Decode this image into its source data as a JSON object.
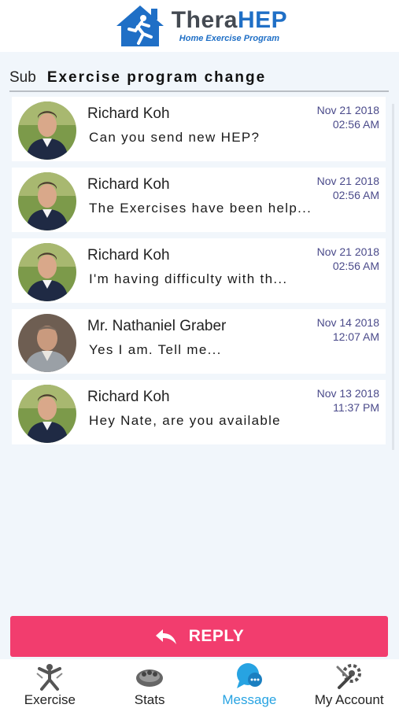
{
  "header": {
    "logo_word_1": "Thera",
    "logo_word_2": "HEP",
    "logo_subtitle": "Home Exercise Program"
  },
  "subject": {
    "label": "Sub",
    "text": "Exercise program change"
  },
  "messages": [
    {
      "name": "Richard Koh",
      "preview": "Can you send new HEP?",
      "date": "Nov 21 2018",
      "time": "02:56 AM",
      "avatar": "richard"
    },
    {
      "name": "Richard Koh",
      "preview": "The Exercises have been help...",
      "date": "Nov 21 2018",
      "time": "02:56 AM",
      "avatar": "richard"
    },
    {
      "name": "Richard Koh",
      "preview": "I'm having difficulty with th...",
      "date": "Nov 21 2018",
      "time": "02:56 AM",
      "avatar": "richard"
    },
    {
      "name": "Mr. Nathaniel Graber",
      "preview": "Yes I am. Tell me...",
      "date": "Nov 14 2018",
      "time": "12:07 AM",
      "avatar": "nathaniel"
    },
    {
      "name": "Richard Koh",
      "preview": "Hey Nate, are you available",
      "date": "Nov 13 2018",
      "time": "11:37 PM",
      "avatar": "richard"
    }
  ],
  "reply": {
    "label": "REPLY"
  },
  "nav": [
    {
      "label": "Exercise",
      "icon": "exercise-icon",
      "active": false
    },
    {
      "label": "Stats",
      "icon": "stats-icon",
      "active": false
    },
    {
      "label": "Message",
      "icon": "message-icon",
      "active": true
    },
    {
      "label": "My Account",
      "icon": "account-icon",
      "active": false
    }
  ],
  "colors": {
    "accent": "#f23d6e",
    "brand_blue": "#1f6fc6",
    "active_nav": "#27a3e2",
    "date_text": "#4a4a8a"
  }
}
